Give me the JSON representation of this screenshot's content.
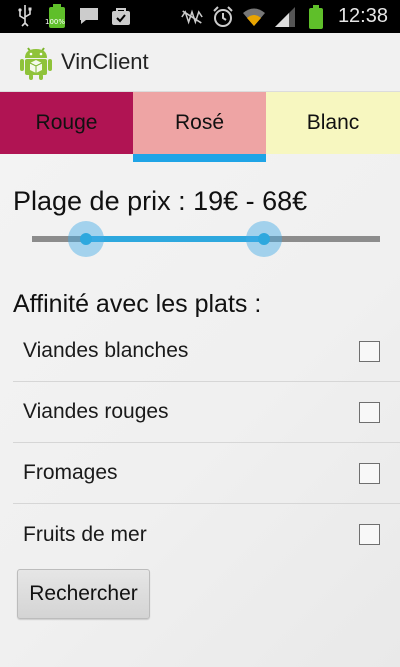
{
  "status_bar": {
    "time": "12:38",
    "battery_small_label": "100%",
    "icons_left": [
      "usb-icon",
      "battery-icon",
      "message-icon",
      "bag-icon"
    ],
    "icons_right": [
      "mute-icon",
      "alarm-icon",
      "wifi-icon",
      "signal-icon",
      "battery-icon"
    ]
  },
  "app": {
    "title": "VinClient",
    "logo_icon": "android-icon"
  },
  "tabs": [
    {
      "label": "Rouge",
      "color": "#b01453",
      "selected": false
    },
    {
      "label": "Rosé",
      "color": "#eea4a4",
      "selected": true
    },
    {
      "label": "Blanc",
      "color": "#f7f7c0",
      "selected": false
    }
  ],
  "accent_color": "#1fa4e6",
  "price_range": {
    "label": "Plage de prix : 19€ - 68€",
    "min_fraction": 0.155,
    "max_fraction": 0.667
  },
  "affinity": {
    "title": "Affinité avec les plats :",
    "items": [
      {
        "label": "Viandes blanches",
        "checked": false
      },
      {
        "label": "Viandes rouges",
        "checked": false
      },
      {
        "label": "Fromages",
        "checked": false
      },
      {
        "label": "Fruits de mer",
        "checked": false
      }
    ]
  },
  "search_button": {
    "label": "Rechercher"
  }
}
